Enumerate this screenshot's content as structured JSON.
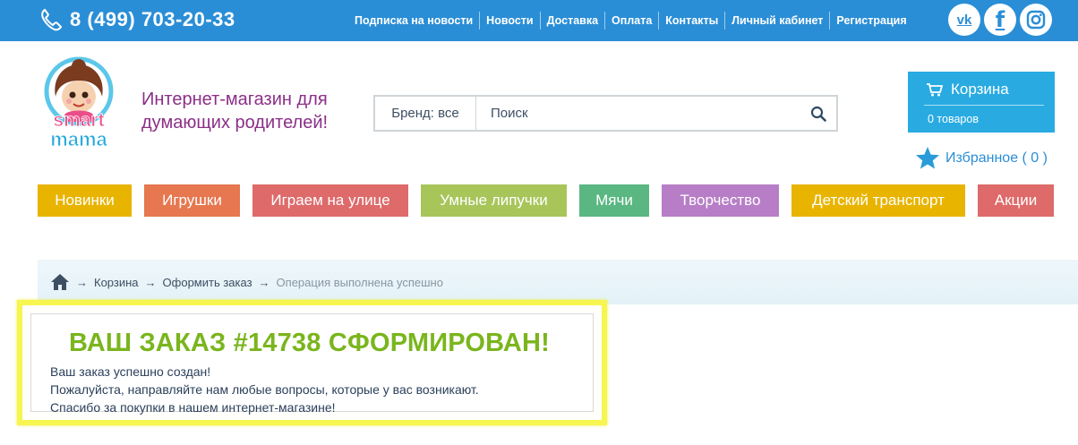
{
  "header": {
    "phone": "8 (499) 703-20-33",
    "nav": [
      "Подписка на новости",
      "Новости",
      "Доставка",
      "Оплата",
      "Контакты",
      "Личный кабинет",
      "Регистрация"
    ],
    "social": {
      "vk": "vk",
      "fb": "f"
    }
  },
  "brand": {
    "logo_top": "smart",
    "logo_bottom": "mama",
    "tagline_line1": "Интернет-магазин для",
    "tagline_line2": "думающих родителей!"
  },
  "search": {
    "brand_filter": "Бренд: все",
    "placeholder": "Поиск"
  },
  "cart": {
    "title": "Корзина",
    "count": "0 товаров"
  },
  "favorites": {
    "label": "Избранное ( 0 )"
  },
  "categories": [
    {
      "label": "Новинки",
      "color": "#e8b400"
    },
    {
      "label": "Игрушки",
      "color": "#e6774f"
    },
    {
      "label": "Играем на улице",
      "color": "#de6a6a"
    },
    {
      "label": "Умные липучки",
      "color": "#a8c55a"
    },
    {
      "label": "Мячи",
      "color": "#5ab782"
    },
    {
      "label": "Творчество",
      "color": "#b77ec7"
    },
    {
      "label": "Детский транспорт",
      "color": "#e8b400"
    },
    {
      "label": "Акции",
      "color": "#de6a6a"
    }
  ],
  "breadcrumb": {
    "items": [
      "Корзина",
      "Оформить заказ"
    ],
    "current": "Операция выполнена успешно",
    "separator": "→"
  },
  "order": {
    "title": "ВАШ ЗАКАЗ #14738 СФОРМИРОВАН!",
    "line1": "Ваш заказ успешно создан!",
    "line2": "Пожалуйста, направляйте нам любые вопросы, которые у вас возникают.",
    "line3": "Спасибо за покупки в нашем интернет-магазине!"
  },
  "colors": {
    "topbar": "#2a8ed6",
    "cart": "#29abe2",
    "tagline": "#8b2f88",
    "order_title": "#7ab51d",
    "highlight": "#f7f54f"
  }
}
